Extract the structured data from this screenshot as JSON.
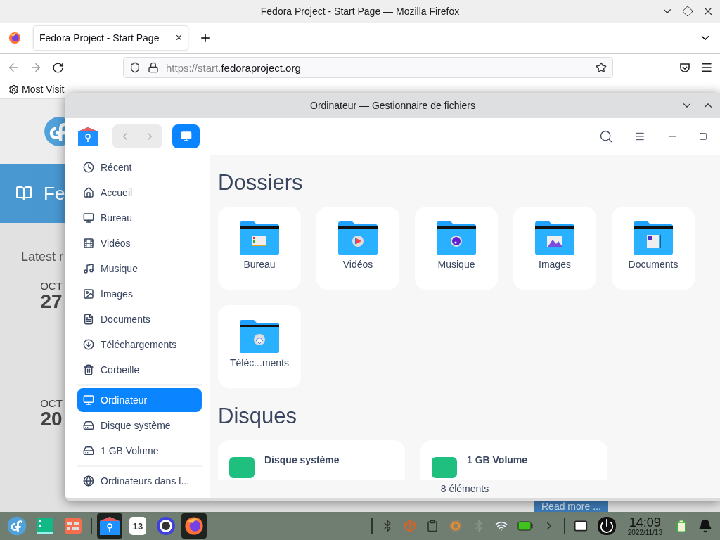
{
  "browser": {
    "title": "Fedora Project - Start Page — Mozilla Firefox",
    "tab": {
      "title": "Fedora Project - Start Page",
      "close": "×"
    },
    "url": {
      "prefix": "https://start.",
      "domain": "fedoraproject.org"
    },
    "bookmark": "Most Visit",
    "page": {
      "banner": "Fe",
      "heading": "Latest r",
      "news": [
        {
          "month": "OCT",
          "day": "27"
        },
        {
          "month": "OCT",
          "day": "20"
        }
      ],
      "read_more": "Read more ..."
    }
  },
  "files": {
    "title": "Ordinateur — Gestionnaire de fichiers",
    "sidebar": [
      [
        {
          "label": "Récent",
          "kind": "recent",
          "selected": false
        },
        {
          "label": "Accueil",
          "kind": "home",
          "selected": false
        },
        {
          "label": "Bureau",
          "kind": "desktop",
          "selected": false
        },
        {
          "label": "Vidéos",
          "kind": "video",
          "selected": false
        },
        {
          "label": "Musique",
          "kind": "music",
          "selected": false
        },
        {
          "label": "Images",
          "kind": "pictures",
          "selected": false
        },
        {
          "label": "Documents",
          "kind": "documents",
          "selected": false
        },
        {
          "label": "Téléchargements",
          "kind": "downloads",
          "selected": false
        },
        {
          "label": "Corbeille",
          "kind": "trash",
          "selected": false
        }
      ],
      [
        {
          "label": "Ordinateur",
          "kind": "computer",
          "selected": true
        },
        {
          "label": "Disque système",
          "kind": "disk",
          "selected": false
        },
        {
          "label": "1 GB Volume",
          "kind": "drive",
          "selected": false
        }
      ],
      [
        {
          "label": "Ordinateurs dans l...",
          "kind": "network",
          "selected": false
        }
      ]
    ],
    "folders_heading": "Dossiers",
    "folders": [
      {
        "label": "Bureau",
        "kind": "desktop"
      },
      {
        "label": "Vidéos",
        "kind": "video"
      },
      {
        "label": "Musique",
        "kind": "music"
      },
      {
        "label": "Images",
        "kind": "pictures"
      },
      {
        "label": "Documents",
        "kind": "documents"
      },
      {
        "label": "Téléc...ments",
        "kind": "downloads"
      }
    ],
    "disks_heading": "Disques",
    "disks": [
      {
        "label": "Disque système"
      },
      {
        "label": "1 GB Volume"
      }
    ],
    "status": "8 éléments"
  },
  "taskbar": {
    "launchers": [
      {
        "kind": "fedora",
        "active": false
      },
      {
        "kind": "terminal",
        "active": false
      },
      {
        "kind": "panels",
        "active": false
      },
      {
        "kind": "files",
        "active": true
      },
      {
        "kind": "calendar",
        "active": false,
        "day": "13"
      },
      {
        "kind": "settings",
        "active": false
      },
      {
        "kind": "firefox",
        "active": true
      }
    ],
    "tray": [
      {
        "kind": "bluetooth",
        "disabled": false
      },
      {
        "kind": "package"
      },
      {
        "kind": "clipboard"
      },
      {
        "kind": "updater"
      },
      {
        "kind": "bluetooth",
        "disabled": true
      },
      {
        "kind": "wifi"
      },
      {
        "kind": "battery"
      },
      {
        "kind": "expand"
      }
    ],
    "tray_right": [
      {
        "kind": "keyboard"
      },
      {
        "kind": "power"
      }
    ],
    "clock": {
      "time": "14:09",
      "date": "2022/11/13"
    },
    "end": [
      {
        "kind": "recycle"
      },
      {
        "kind": "bell"
      }
    ]
  }
}
